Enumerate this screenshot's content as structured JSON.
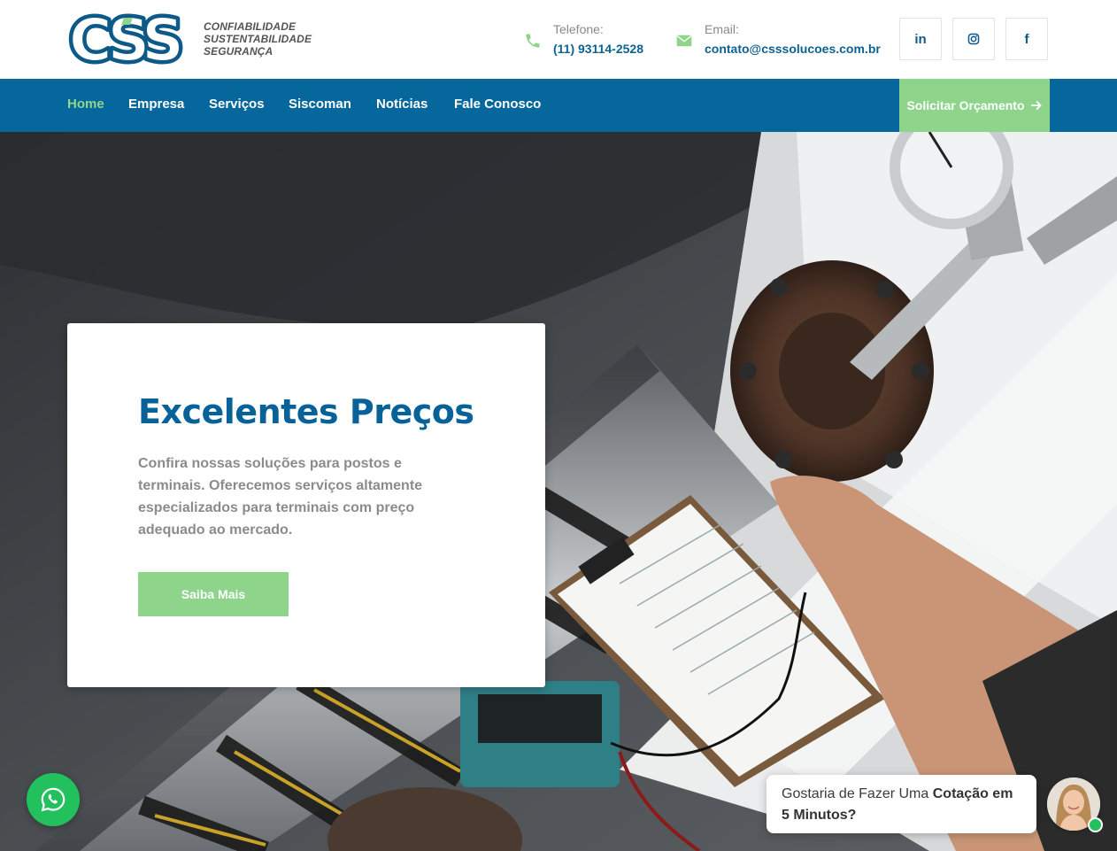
{
  "brand": {
    "logo_text": "CSS",
    "tagline": [
      "CONFIABILIDADE",
      "SUSTENTABILIDADE",
      "SEGURANÇA"
    ],
    "colors": {
      "primary": "#05679b",
      "accent": "#8ed48b",
      "logo_blue": "#0d5a88"
    }
  },
  "header": {
    "phone": {
      "icon": "phone-icon",
      "label": "Telefone:",
      "value": "(11) 93114-2528"
    },
    "email": {
      "icon": "envelope-icon",
      "label": "Email:",
      "value": "contato@csssolucoes.com.br"
    },
    "social": [
      {
        "name": "linkedin-icon",
        "glyph": "in"
      },
      {
        "name": "instagram-icon",
        "glyph": ""
      },
      {
        "name": "facebook-icon",
        "glyph": "f"
      }
    ]
  },
  "nav": {
    "items": [
      "Home",
      "Empresa",
      "Serviços",
      "Siscoman",
      "Notícias",
      "Fale Conosco"
    ],
    "active": "Home",
    "cta_label": "Solicitar Orçamento",
    "cta_icon": "arrow-right-icon"
  },
  "hero": {
    "title": "Excelentes Preços",
    "description": "Confira nossas soluções para postos e terminais. Oferecemos serviços altamente especializados para terminais com preço adequado ao mercado.",
    "button_label": "Saiba Mais"
  },
  "widgets": {
    "whatsapp_icon": "whatsapp-icon",
    "chat_text_plain": "Gostaria de Fazer Uma ",
    "chat_text_bold": "Cotação em 5 Minutos?",
    "avatar_icon": "agent-avatar-icon"
  }
}
